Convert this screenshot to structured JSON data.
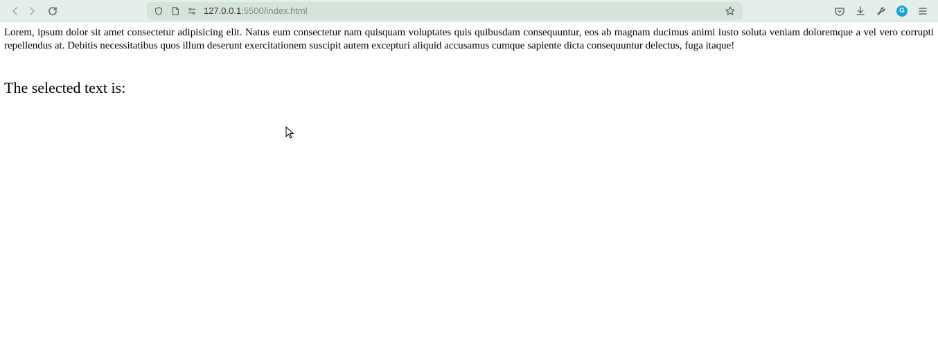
{
  "toolbar": {
    "url_host": "127.0.0.1",
    "url_port_path": ":5500/index.html"
  },
  "extension_badge": "G",
  "page": {
    "paragraph": "Lorem, ipsum dolor sit amet consectetur adipisicing elit. Natus eum consectetur nam quisquam voluptates quis quibusdam consequuntur, eos ab magnam ducimus animi iusto soluta veniam doloremque a vel vero corrupti repellendus at. Debitis necessitatibus quos illum deserunt exercitationem suscipit autem excepturi aliquid accusamus cumque sapiente dicta consequuntur delectus, fuga itaque!",
    "selected_text_label": "The selected text is:"
  }
}
